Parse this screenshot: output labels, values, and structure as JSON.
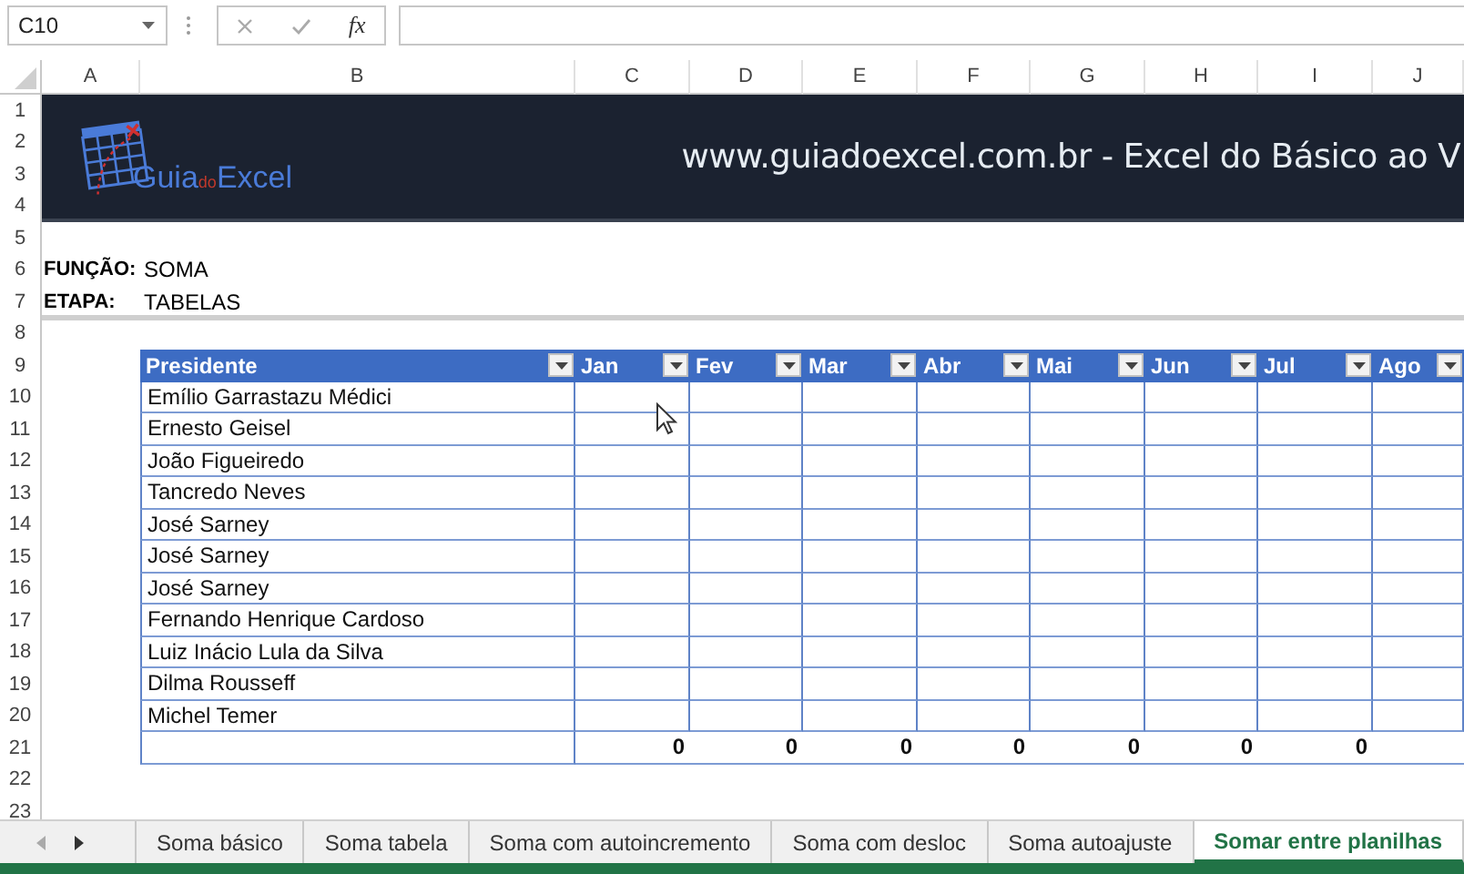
{
  "formula_bar": {
    "name_box": "C10",
    "function_label": "fx"
  },
  "column_headers": [
    "A",
    "B",
    "C",
    "D",
    "E",
    "F",
    "G",
    "H",
    "I",
    "J"
  ],
  "row_headers": [
    "1",
    "2",
    "3",
    "4",
    "5",
    "6",
    "7",
    "8",
    "9",
    "10",
    "11",
    "12",
    "13",
    "14",
    "15",
    "16",
    "17",
    "18",
    "19",
    "20",
    "21",
    "22",
    "23"
  ],
  "banner": {
    "logo": {
      "part_1": "Guia",
      "part_2": "do",
      "part_3": "Excel"
    },
    "title": "www.guiadoexcel.com.br - Excel do Básico ao V"
  },
  "info": [
    {
      "label": "FUNÇÃO:",
      "value": "SOMA"
    },
    {
      "label": "ETAPA:",
      "value": "TABELAS"
    }
  ],
  "table": {
    "columns": [
      "Presidente",
      "Jan",
      "Fev",
      "Mar",
      "Abr",
      "Mai",
      "Jun",
      "Jul",
      "Ago"
    ],
    "rows": [
      "Emílio Garrastazu Médici",
      "Ernesto Geisel",
      "João Figueiredo",
      "Tancredo Neves",
      "José Sarney",
      "José Sarney",
      "José Sarney",
      "Fernando Henrique Cardoso",
      "Luiz Inácio Lula da Silva",
      "Dilma Rousseff",
      "Michel Temer"
    ],
    "totals": [
      "0",
      "0",
      "0",
      "0",
      "0",
      "0",
      "0"
    ]
  },
  "sheet_tabs": [
    {
      "label": "Soma básico",
      "selected": false
    },
    {
      "label": "Soma tabela",
      "selected": false
    },
    {
      "label": "Soma com autoincremento",
      "selected": false
    },
    {
      "label": "Soma com desloc",
      "selected": false
    },
    {
      "label": "Soma autoajuste",
      "selected": false
    },
    {
      "label": "Somar entre planilhas",
      "selected": true
    }
  ]
}
